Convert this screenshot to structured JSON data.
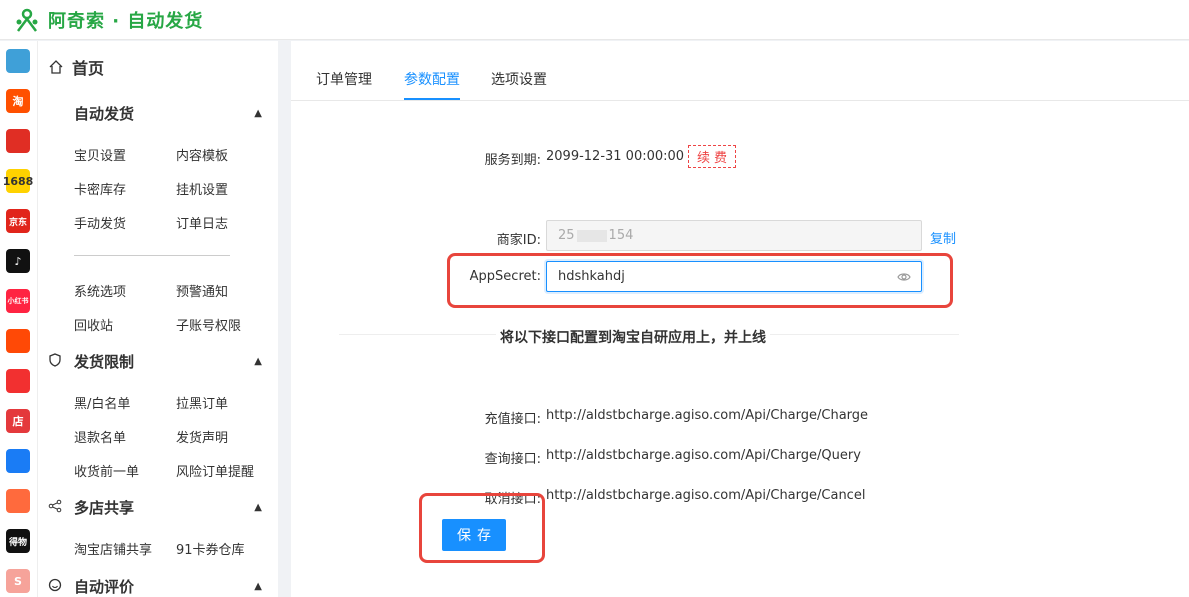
{
  "app": {
    "title": "阿奇索 · 自动发货"
  },
  "rail": {
    "items": [
      {
        "name": "grid-apps-icon",
        "text": "",
        "color": "#3fa0d8"
      },
      {
        "name": "taobao-icon",
        "text": "淘",
        "color": "#ff5000"
      },
      {
        "name": "pinduoduo-icon",
        "text": "",
        "color": "#e02e24"
      },
      {
        "name": "alibaba-icon",
        "text": "1688",
        "color": "#ffd200"
      },
      {
        "name": "jd-icon",
        "text": "京东",
        "color": "#e1251b"
      },
      {
        "name": "douyin-icon",
        "text": "♪",
        "color": "#111111"
      },
      {
        "name": "xiaohongshu-icon",
        "text": "小红书",
        "color": "#ff2442"
      },
      {
        "name": "kuaishou-icon",
        "text": "",
        "color": "#ff4906"
      },
      {
        "name": "like-icon",
        "text": "",
        "color": "#f23030"
      },
      {
        "name": "store-icon",
        "text": "店",
        "color": "#e4393c"
      },
      {
        "name": "link-icon",
        "text": "",
        "color": "#1a7cf5"
      },
      {
        "name": "shop-icon",
        "text": "",
        "color": "#ff6a3d"
      },
      {
        "name": "dewu-icon",
        "text": "得物",
        "color": "#111111"
      },
      {
        "name": "shopee-icon",
        "text": "S",
        "color": "#f6a39a"
      }
    ]
  },
  "sidebar": {
    "home": "首页",
    "groups": [
      {
        "title": "自动发货",
        "items": [
          "宝贝设置",
          "内容模板",
          "卡密库存",
          "挂机设置",
          "手动发货",
          "订单日志"
        ],
        "items2": [
          "系统选项",
          "预警通知",
          "回收站",
          "子账号权限"
        ]
      },
      {
        "title": "发货限制",
        "items": [
          "黑/白名单",
          "拉黑订单",
          "退款名单",
          "发货声明",
          "收货前一单",
          "风险订单提醒"
        ]
      },
      {
        "title": "多店共享",
        "items": [
          "淘宝店铺共享",
          "91卡券仓库"
        ]
      },
      {
        "title": "自动评价"
      }
    ]
  },
  "tabs": [
    "订单管理",
    "参数配置",
    "选项设置"
  ],
  "form": {
    "service_label": "服务到期:",
    "service_value": "2099-12-31 00:00:00",
    "renew": "续费",
    "merchant_label": "商家ID:",
    "merchant_prefix": "25",
    "merchant_suffix": "154",
    "copy": "复制",
    "secret_label": "AppSecret:",
    "secret_value": "hdshkahdj",
    "section_title": "将以下接口配置到淘宝自研应用上，并上线",
    "apis": [
      {
        "label": "充值接口:",
        "url": "http://aldstbcharge.agiso.com/Api/Charge/Charge"
      },
      {
        "label": "查询接口:",
        "url": "http://aldstbcharge.agiso.com/Api/Charge/Query"
      },
      {
        "label": "取消接口:",
        "url": "http://aldstbcharge.agiso.com/Api/Charge/Cancel"
      }
    ],
    "save": "保存"
  },
  "colors": {
    "brand": "#27a745",
    "accent": "#1890ff",
    "highlight": "#e8453c"
  }
}
